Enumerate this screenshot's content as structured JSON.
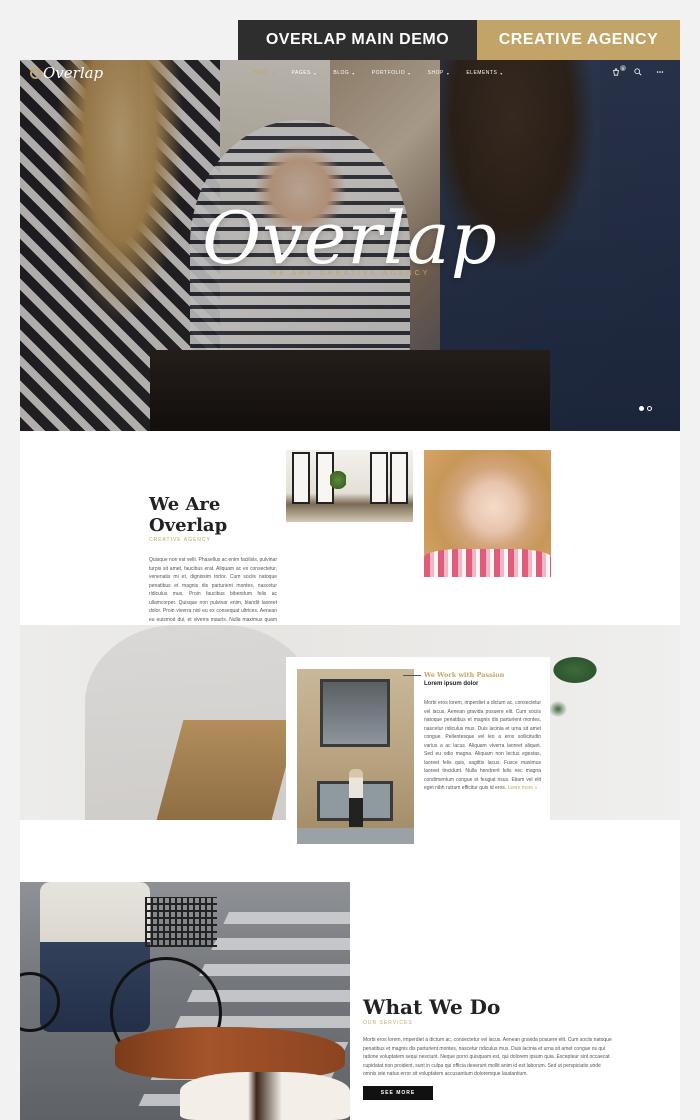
{
  "ribbon": {
    "left_label": "OVERLAP MAIN DEMO",
    "right_label": "CREATIVE AGENCY",
    "colors": {
      "dark": "#2e2e2e",
      "gold": "#c2a468"
    }
  },
  "header": {
    "logo": "Overlap",
    "nav": [
      {
        "label": "HOME",
        "active": true
      },
      {
        "label": "PAGES"
      },
      {
        "label": "BLOG"
      },
      {
        "label": "PORTFOLIO"
      },
      {
        "label": "SHOP"
      },
      {
        "label": "ELEMENTS"
      }
    ],
    "icons": [
      "cart-icon",
      "search-icon",
      "menu-dots-icon"
    ],
    "cart_count": "0"
  },
  "hero": {
    "title": "Overlap",
    "subtitle": "WE ARE CREATIVE AGENCY",
    "slides": 2,
    "active_slide": 1
  },
  "about": {
    "title_line1": "We Are",
    "title_line2": "Overlap",
    "subtitle": "CREATIVE AGENCY",
    "text": "Quisque non est velit. Phasellus ac enim facilisis, pulvinar turpis sit amet, faucibus erat. Aliquam ac ex consectetur, venenatis mi et, dignissim tortor. Cum sociis natoque penatibus et magnis dis parturient montes, nascetur ridiculus mus. Proin faucibus bibendum felis ac ullamcorper. Quisque non pulvinar enim, blandit laoreet dolor. Proin viverra nisl eu ex consequat ultrices. Aenean eu euismod dui, et viverra mauris. Nulla maximus quam et felis porta, ut feugiat metus sagittis. Vivamus consequat sodales magna. Cum sociis natoque penatibus et magnis dis parturient montes, nascetur ridiculus mus."
  },
  "work_card": {
    "title": "We Work with Passion",
    "subtitle": "Lorem ipsum dolor",
    "text": "Morbi eros lorem, imperdiet a dictum ac, consectetur vel lacus. Aenean gravida posuere elit. Cum sociis natoque penatibus et magnis dis parturient montes, nascetur ridiculus mus. Duis lacinia et urna sit amet congue. Pellentesque vel leo a eros sollicitudin varius a ac lacus. Aliquam viverra laoreet aliquet. Sed eu odio magna. Aliquam non lectus egestas, laoreet felis quis, sagittis lacus. Fusce maximus laoreet tincidunt. Nulla hendrerit felis nec magna condimentum congue et feugiat risus. Etiam vel elit eget nibh rutrum efficitur quis id eros.",
    "more": "Learn more »"
  },
  "what_we_do": {
    "title": "What We Do",
    "subtitle": "OUR SERVICES",
    "text": "Morbi eros lorem, imperdiet a dictum ac, consectetur vel lacus. Aenean gravida posuere elit. Cum sociis natoque penatibus et magnis dis parturient montes, nascetur ridiculus mus. Duis lacinia et urna sit amet congue os qui ratione voluptatem sequi nesciunt. Neque porro quisquam est, qui dolorem ipsum quia. Excepteur sint occaecat cupidatat non proident, sunt in culpa qui officia deserunt mollit anim id est laborum. Sed ut perspiciatis unde omnis iste natus error sit voluptatem accusantium doloremque laudantium.",
    "button": "SEE MORE"
  }
}
